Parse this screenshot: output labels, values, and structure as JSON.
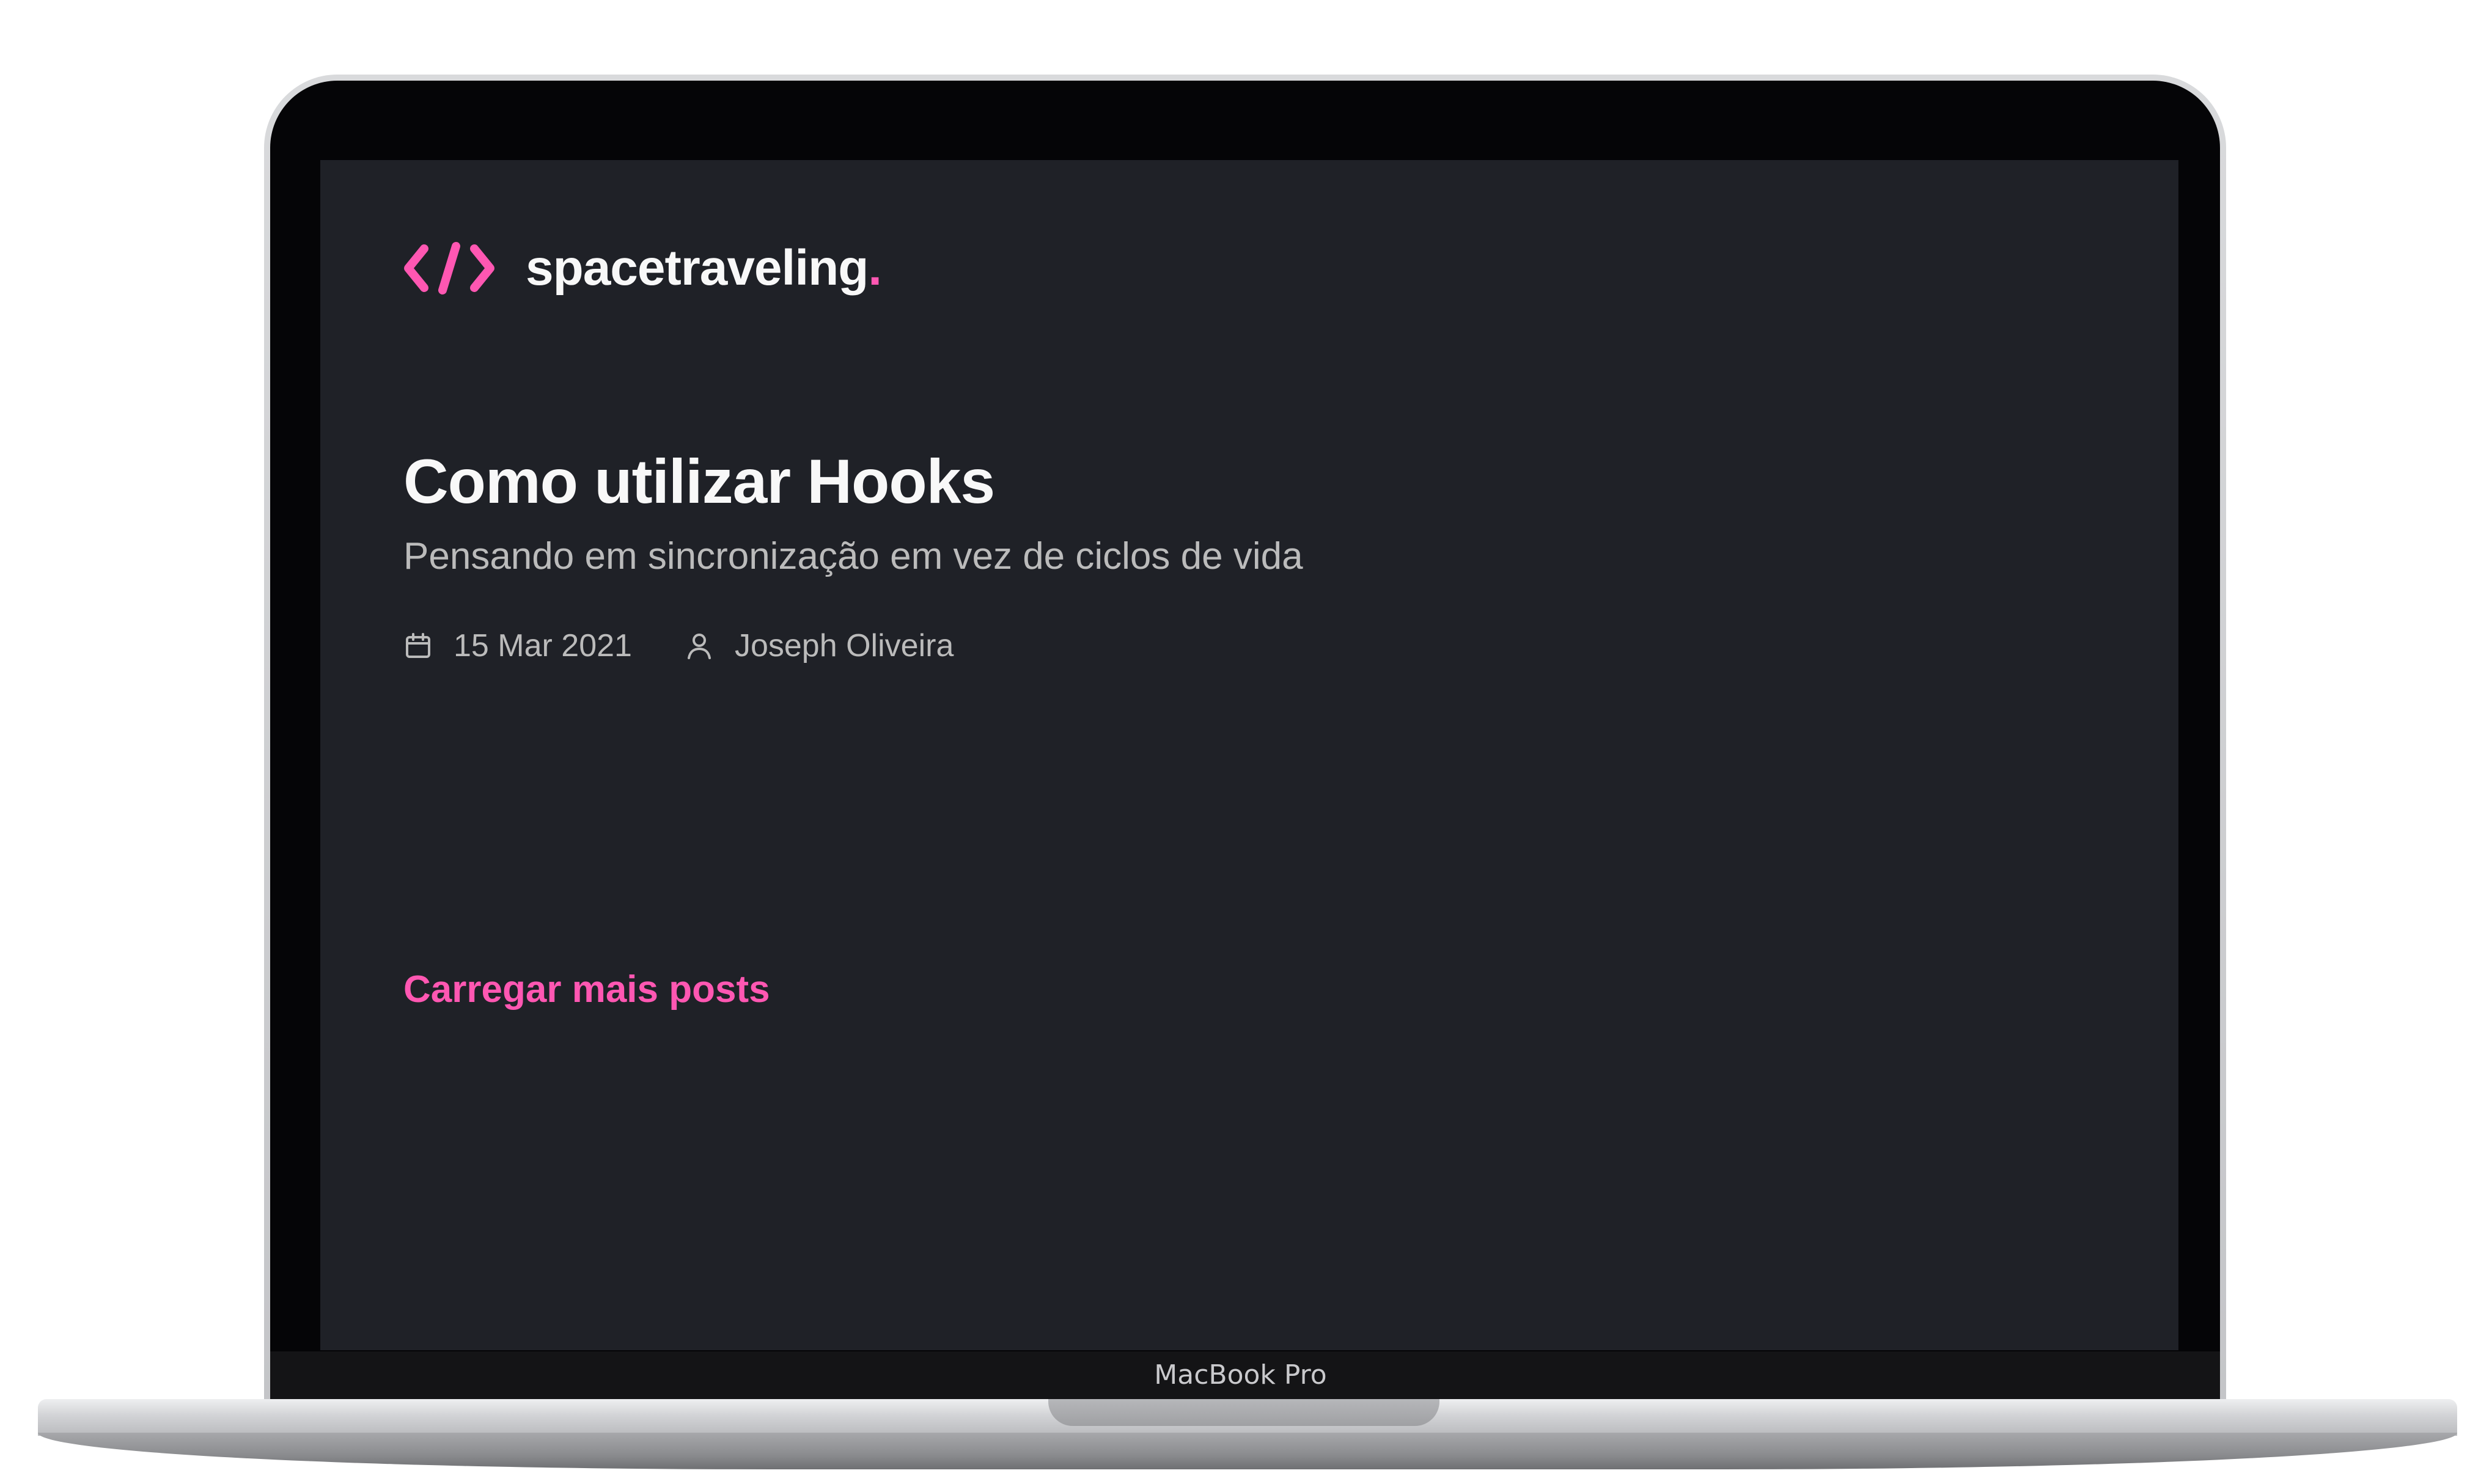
{
  "device": {
    "label": "MacBook Pro"
  },
  "header": {
    "logo_icon": "code-brackets-icon",
    "brand_name": "spacetraveling",
    "brand_dot": "."
  },
  "posts": [
    {
      "title": "Como utilizar Hooks",
      "subtitle": "Pensando em sincronização em vez de ciclos de vida",
      "date_icon": "calendar-icon",
      "date": "15 Mar 2021",
      "author_icon": "user-icon",
      "author": "Joseph Oliveira"
    }
  ],
  "actions": {
    "load_more_label": "Carregar mais posts"
  },
  "colors": {
    "background": "#1f2127",
    "accent": "#ff57b2",
    "heading": "#f8f8f8",
    "body_text": "#bbbbbb"
  }
}
